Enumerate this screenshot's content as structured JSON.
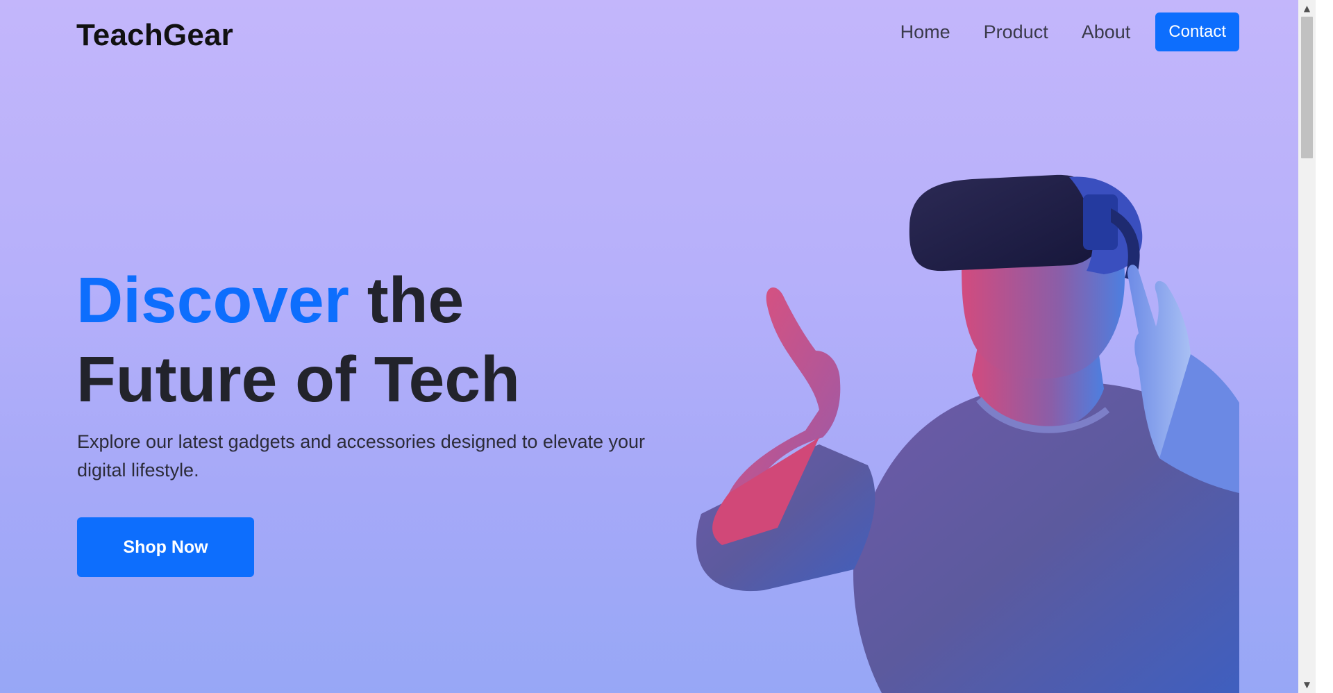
{
  "brand": "TeachGear",
  "nav": {
    "links": [
      "Home",
      "Product",
      "About"
    ],
    "contact": "Contact"
  },
  "hero": {
    "title_accent": "Discover",
    "title_rest_line1": " the",
    "title_line2": "Future of Tech",
    "subtitle": "Explore our latest gadgets and accessories designed to elevate your digital lifestyle.",
    "cta": "Shop Now",
    "image": "man-wearing-vr-headset-pointing"
  },
  "colors": {
    "accent": "#0d6efd",
    "bg_top": "#c3b6fb",
    "bg_bottom": "#97a7f6"
  }
}
